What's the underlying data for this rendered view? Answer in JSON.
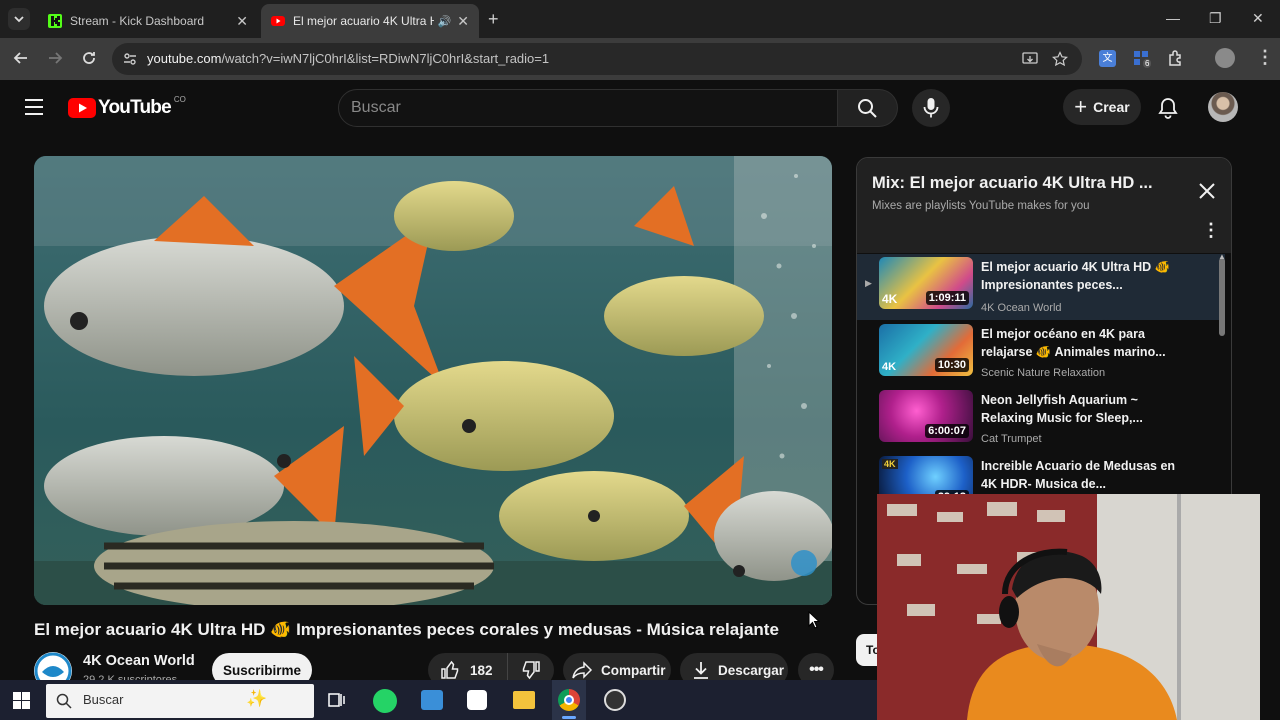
{
  "browser": {
    "tabs": [
      {
        "label": "Stream - Kick Dashboard",
        "active": false
      },
      {
        "label": "El mejor acuario 4K Ultra HD",
        "active": true
      }
    ],
    "url_host": "youtube.com",
    "url_rest": "/watch?v=iwN7ljC0hrI&list=RDiwN7ljC0hrI&start_radio=1",
    "extension_badge": "6"
  },
  "youtube": {
    "logo_text": "YouTube",
    "country_code": "CO",
    "search_placeholder": "Buscar",
    "create_label": "Crear"
  },
  "video": {
    "title": "El mejor acuario 4K Ultra HD 🐠 Impresionantes peces corales y medusas - Música relajante",
    "channel": "4K Ocean World",
    "subscribers": "29,2 K suscriptores",
    "subscribe_label": "Suscribirme",
    "likes": "182",
    "share_label": "Compartir",
    "download_label": "Descargar",
    "side_pill_partial": "To"
  },
  "mix": {
    "title": "Mix: El mejor acuario 4K Ultra HD ...",
    "subtitle": "Mixes are playlists YouTube makes for you",
    "items": [
      {
        "title": "El mejor acuario 4K Ultra HD 🐠 Impresionantes peces...",
        "channel": "4K Ocean World",
        "duration": "1:09:11",
        "badge": "4K"
      },
      {
        "title": "El mejor océano en 4K para relajarse 🐠 Animales marino...",
        "channel": "Scenic Nature Relaxation",
        "duration": "10:30",
        "badge": "4K"
      },
      {
        "title": "Neon Jellyfish Aquarium ~ Relaxing Music for Sleep,...",
        "channel": "Cat Trumpet",
        "duration": "6:00:07",
        "badge": ""
      },
      {
        "title": "Increible Acuario de Medusas en 4K HDR- Musica de...",
        "channel": "",
        "duration": "29:13",
        "badge": "4K"
      }
    ]
  },
  "taskbar": {
    "search_placeholder": "Buscar"
  },
  "colors": {
    "background": "#0f0f0f",
    "youtube_red": "#ff0000",
    "kick_green": "#53fc18",
    "subscribe_bg": "#f1f1f1"
  }
}
